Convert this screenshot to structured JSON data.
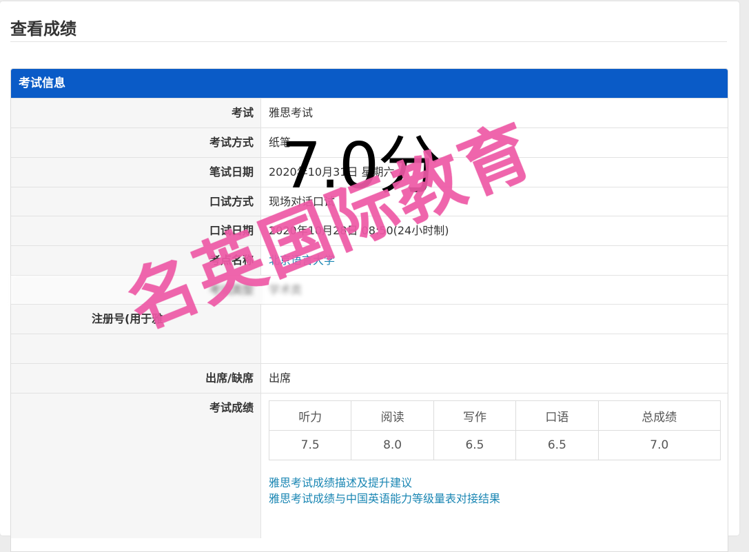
{
  "page": {
    "title": "查看成绩"
  },
  "panel": {
    "header": "考试信息"
  },
  "rows": [
    {
      "label": "考试",
      "value": "雅思考试"
    },
    {
      "label": "考试方式",
      "value": "纸笔"
    },
    {
      "label": "笔试日期",
      "value": "2020年10月31日 星期六"
    },
    {
      "label": "口试方式",
      "value": "现场对话口试"
    },
    {
      "label": "口试日期",
      "value": "2020年10月28日 08:50(24小时制)"
    },
    {
      "label": "考点名称",
      "value": "北京语言大学"
    },
    {
      "label": "考试类型",
      "value": "学术类"
    },
    {
      "label": "注册号(用于雅",
      "value": ""
    },
    {
      "label": "",
      "value": ""
    },
    {
      "label": "出席/缺席",
      "value": "出席"
    },
    {
      "label": "考试成绩",
      "value": ""
    }
  ],
  "scores": {
    "headers": [
      "听力",
      "阅读",
      "写作",
      "口语",
      "总成绩"
    ],
    "values": [
      "7.5",
      "8.0",
      "6.5",
      "6.5",
      "7.0"
    ]
  },
  "links": [
    "雅思考试成绩描述及提升建议",
    "雅思考试成绩与中国英语能力等级量表对接结果"
  ],
  "overlay": {
    "score_text": "7.0分",
    "watermark_text": "名英国际教育",
    "watermark_color": "#ee59a6"
  },
  "colors": {
    "header_bg": "#0a5bc7",
    "link": "#1a86b3"
  }
}
